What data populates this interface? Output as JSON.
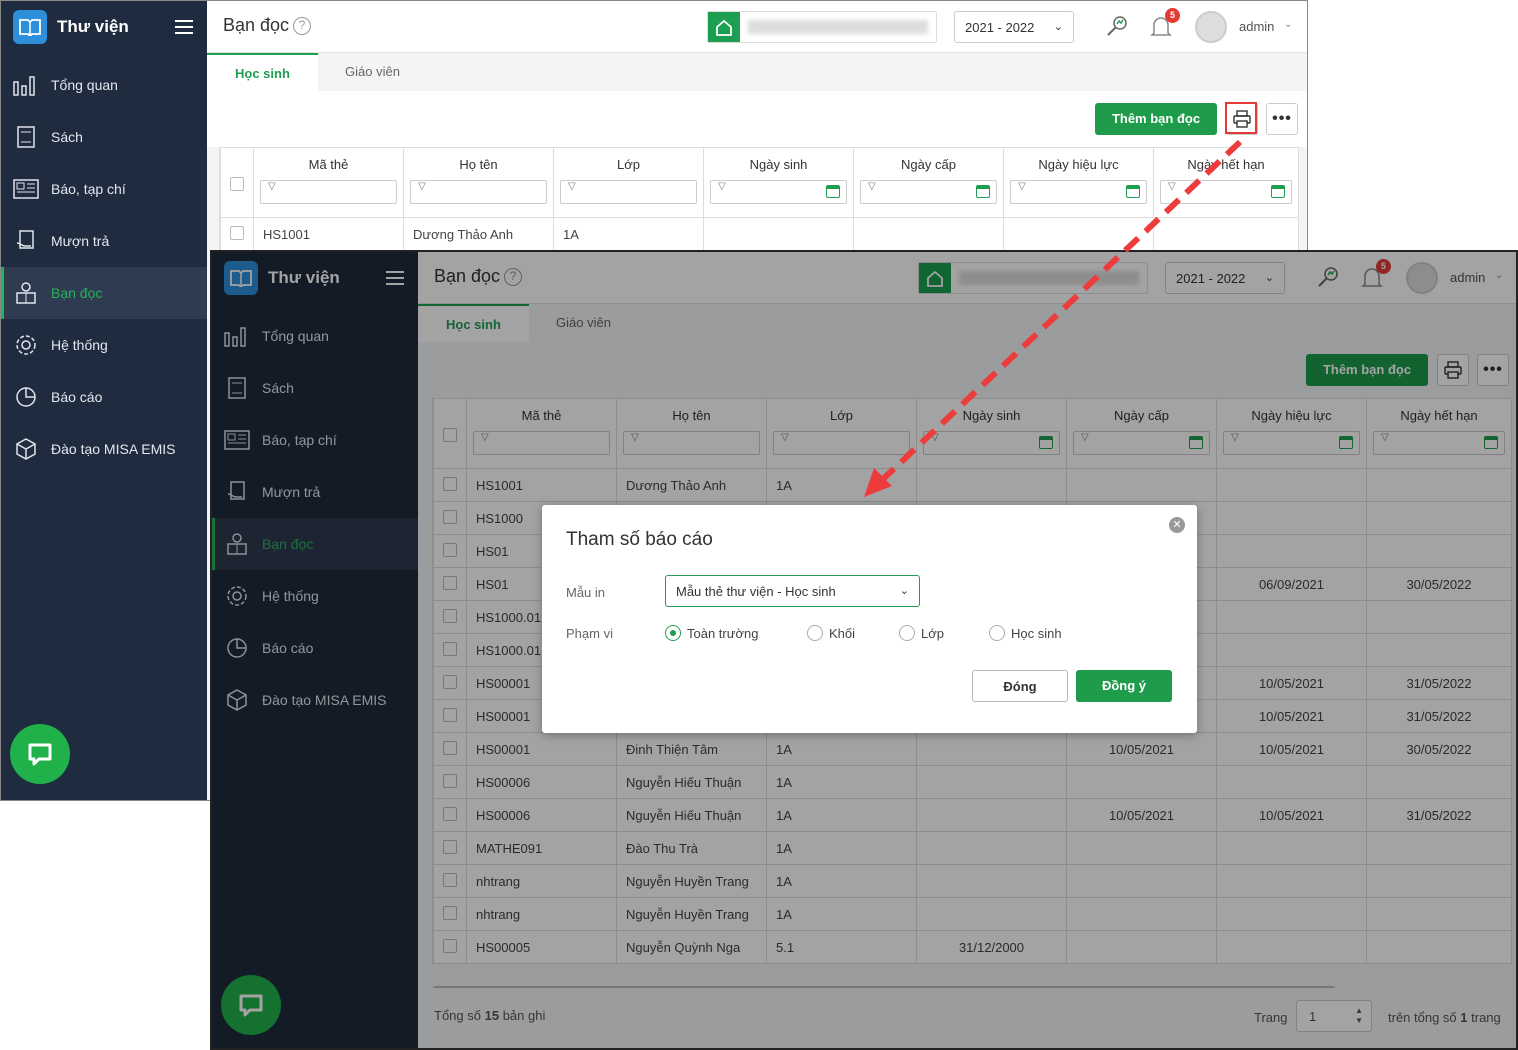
{
  "app": {
    "title": "Thư viện",
    "page_title": "Bạn đọc",
    "school_year": "2021 - 2022",
    "notifications_count": "5",
    "user": "admin"
  },
  "sidebar": {
    "items": [
      {
        "label": "Tổng quan",
        "icon": "bar-chart-icon"
      },
      {
        "label": "Sách",
        "icon": "book-icon"
      },
      {
        "label": "Báo, tạp chí",
        "icon": "newspaper-icon"
      },
      {
        "label": "Mượn trả",
        "icon": "borrow-icon"
      },
      {
        "label": "Bạn đọc",
        "icon": "reader-icon",
        "active": true
      },
      {
        "label": "Hệ thống",
        "icon": "gear-icon"
      },
      {
        "label": "Báo cáo",
        "icon": "pie-chart-icon"
      },
      {
        "label": "Đào tạo MISA EMIS",
        "icon": "cube-icon"
      }
    ]
  },
  "tabs": [
    "Học sinh",
    "Giáo viên"
  ],
  "toolbar": {
    "add_label": "Thêm bạn đọc"
  },
  "table": {
    "columns": [
      "Mã thẻ",
      "Họ tên",
      "Lớp",
      "Ngày sinh",
      "Ngày cấp",
      "Ngày hiệu lực",
      "Ngày hết hạn"
    ],
    "top_row": [
      "HS1001",
      "Dương Thảo Anh",
      "1A",
      "",
      "",
      "",
      ""
    ],
    "rows": [
      [
        "HS1001",
        "Dương Thảo Anh",
        "1A",
        "",
        "",
        "",
        ""
      ],
      [
        "HS1000",
        "",
        "",
        "",
        "",
        "",
        ""
      ],
      [
        "HS01",
        "",
        "",
        "",
        "",
        "",
        ""
      ],
      [
        "HS01",
        "",
        "",
        "",
        "",
        "06/09/2021",
        "30/05/2022"
      ],
      [
        "HS1000.01",
        "",
        "",
        "",
        "",
        "",
        ""
      ],
      [
        "HS1000.01",
        "",
        "",
        "",
        "",
        "",
        ""
      ],
      [
        "HS00001",
        "",
        "",
        "",
        "",
        "10/05/2021",
        "31/05/2022"
      ],
      [
        "HS00001",
        "",
        "",
        "",
        "",
        "10/05/2021",
        "31/05/2022"
      ],
      [
        "HS00001",
        "Đinh Thiện Tâm",
        "1A",
        "",
        "10/05/2021",
        "10/05/2021",
        "30/05/2022"
      ],
      [
        "HS00006",
        "Nguyễn Hiếu Thuận",
        "1A",
        "",
        "",
        "",
        ""
      ],
      [
        "HS00006",
        "Nguyễn Hiếu Thuận",
        "1A",
        "",
        "10/05/2021",
        "10/05/2021",
        "31/05/2022"
      ],
      [
        "MATHE091",
        "Đào Thu Trà",
        "1A",
        "",
        "",
        "",
        ""
      ],
      [
        "nhtrang",
        "Nguyễn Huyền Trang",
        "1A",
        "",
        "",
        "",
        ""
      ],
      [
        "nhtrang",
        "Nguyễn Huyền Trang",
        "1A",
        "",
        "",
        "",
        ""
      ],
      [
        "HS00005",
        "Nguyễn Quỳnh Nga",
        "5.1",
        "31/12/2000",
        "",
        "",
        ""
      ]
    ]
  },
  "footer": {
    "total_prefix": "Tổng số",
    "total": "15",
    "total_suffix": "bản ghi",
    "page_label": "Trang",
    "page": "1",
    "pages_prefix": "trên tổng số",
    "pages": "1",
    "pages_suffix": "trang"
  },
  "dialog": {
    "title": "Tham số báo cáo",
    "template_label": "Mẫu in",
    "template_value": "Mẫu thẻ thư viện - Học sinh",
    "scope_label": "Phạm vi",
    "scope_options": [
      "Toàn trường",
      "Khối",
      "Lớp",
      "Học sinh"
    ],
    "scope_selected": "Toàn trường",
    "cancel": "Đóng",
    "ok": "Đồng ý"
  },
  "colors": {
    "sidebar_bg": "#1f2b3e",
    "accent_green": "#1f9b4c",
    "highlight_red": "#e53935"
  }
}
